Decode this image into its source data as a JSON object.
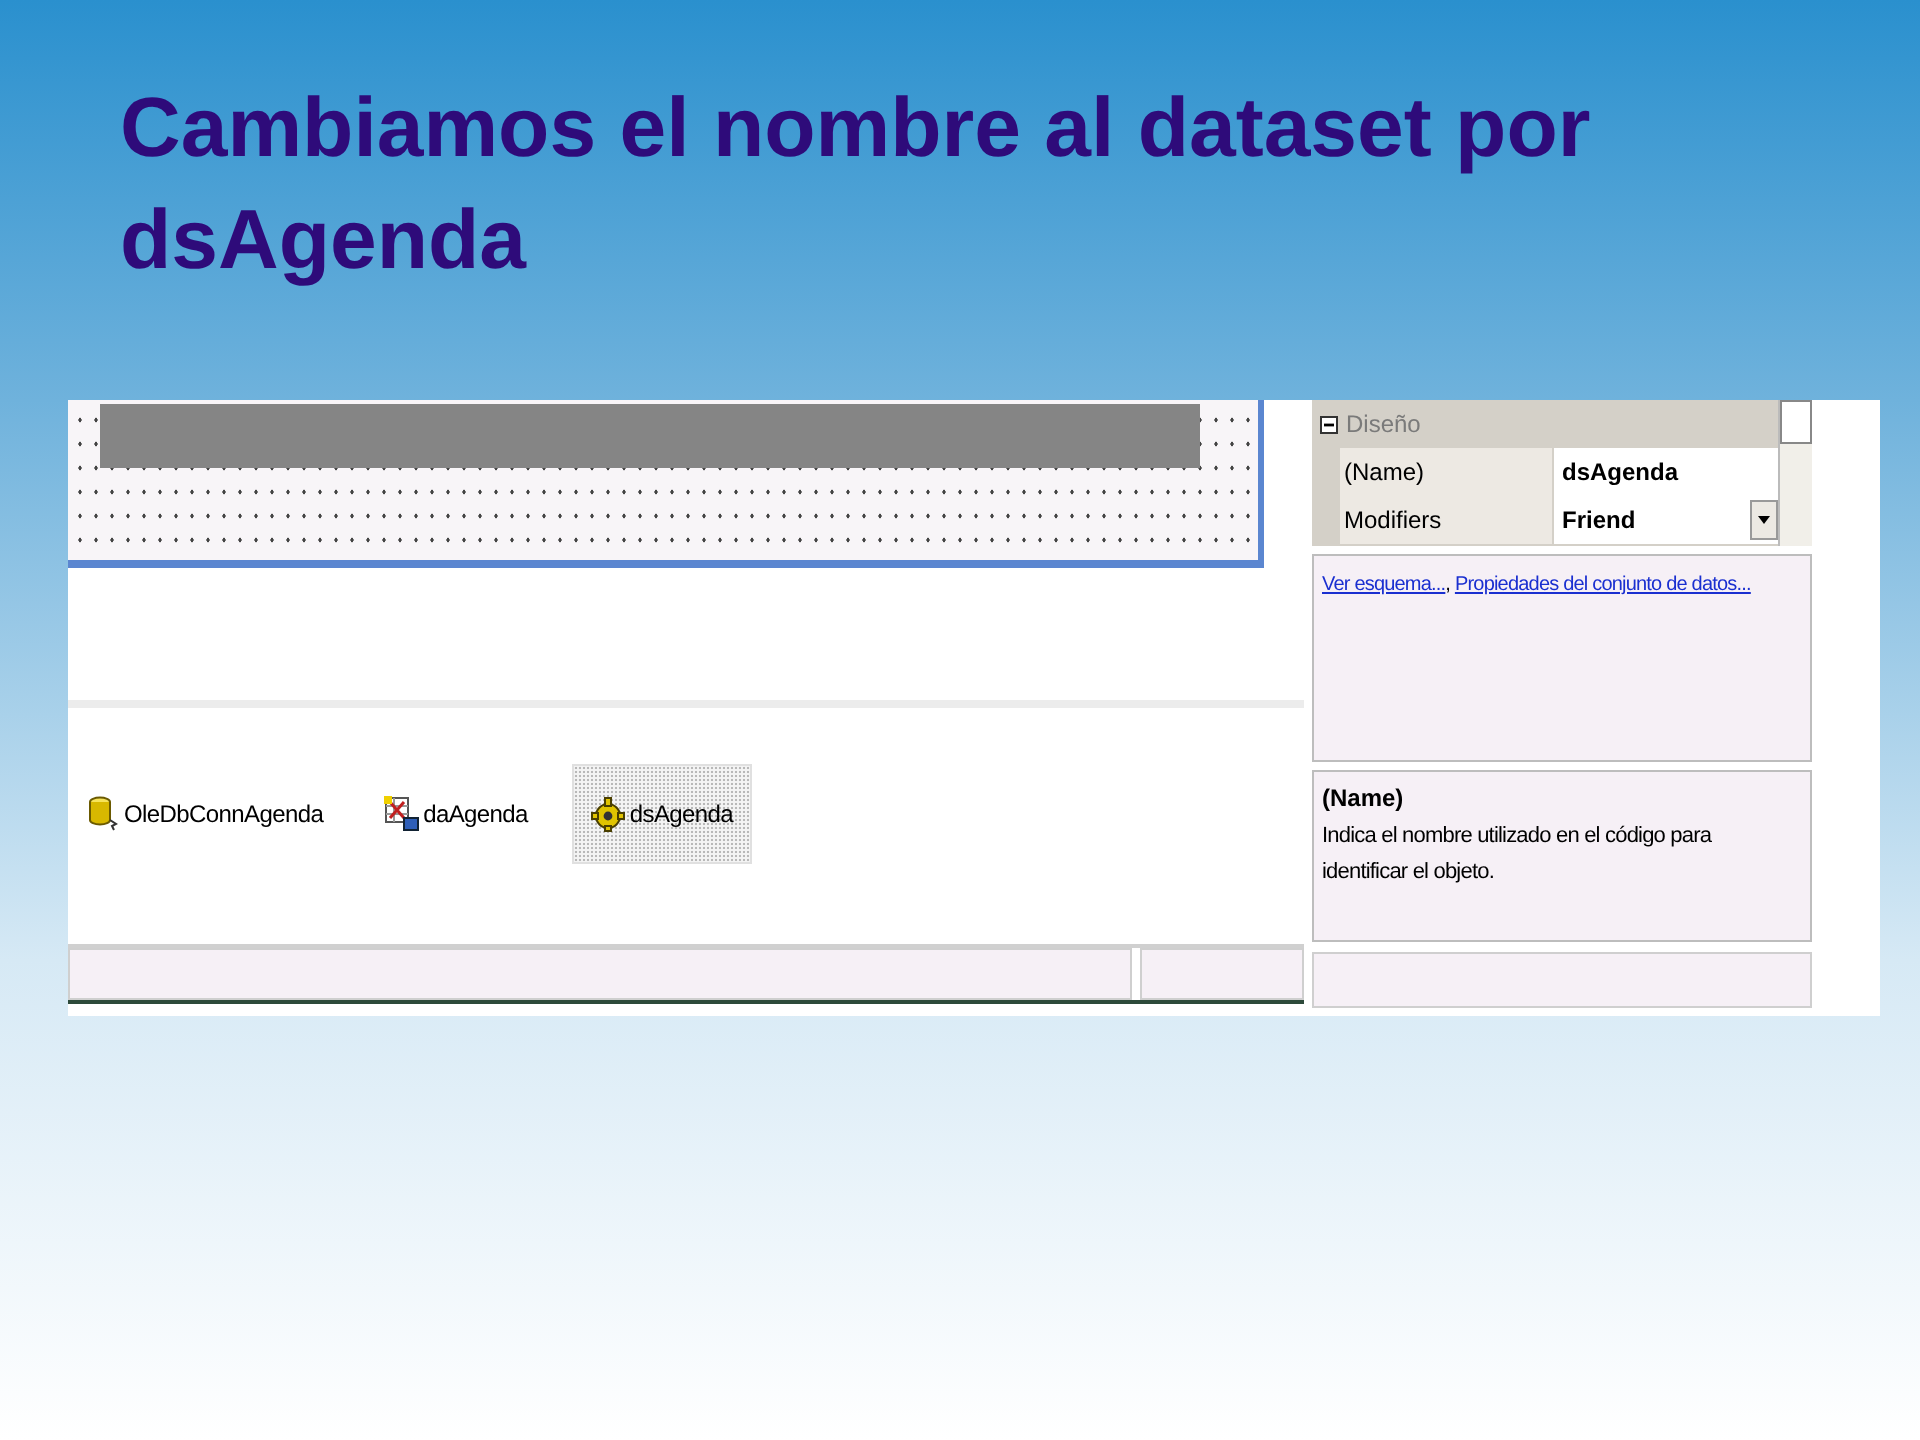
{
  "title": "Cambiamos el nombre al dataset por dsAgenda",
  "component_tray": {
    "items": [
      {
        "label": "OleDbConnAgenda",
        "kind": "connection",
        "selected": false
      },
      {
        "label": "daAgenda",
        "kind": "adapter",
        "selected": false
      },
      {
        "label": "dsAgenda",
        "kind": "dataset",
        "selected": true
      }
    ]
  },
  "properties": {
    "category": {
      "label": "Diseño",
      "expanded": true
    },
    "rows": [
      {
        "name": "(Name)",
        "value": "dsAgenda",
        "dropdown": false
      },
      {
        "name": "Modifiers",
        "value": "Friend",
        "dropdown": true
      }
    ]
  },
  "commands": {
    "links": [
      "Ver esquema...",
      "Propiedades del conjunto de datos..."
    ],
    "separator": ","
  },
  "description": {
    "title": "(Name)",
    "text": "Indica el nombre utilizado en el código para identificar el objeto."
  }
}
